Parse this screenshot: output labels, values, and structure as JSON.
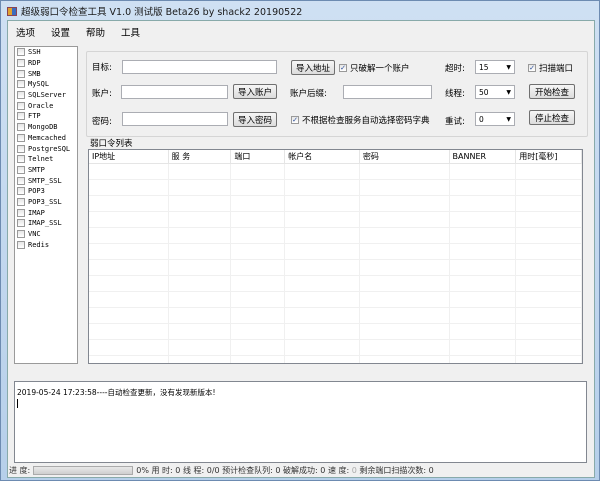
{
  "window": {
    "title": "超级弱口令检查工具 V1.0 测试版 Beta26 by shack2 20190522"
  },
  "menu": [
    "选项",
    "设置",
    "帮助",
    "工具"
  ],
  "services": [
    {
      "name": "SSH",
      "checked": false
    },
    {
      "name": "RDP",
      "checked": false
    },
    {
      "name": "SMB",
      "checked": false
    },
    {
      "name": "MySQL",
      "checked": false
    },
    {
      "name": "SQLServer",
      "checked": false
    },
    {
      "name": "Oracle",
      "checked": false
    },
    {
      "name": "FTP",
      "checked": false
    },
    {
      "name": "MongoDB",
      "checked": false
    },
    {
      "name": "Memcached",
      "checked": false
    },
    {
      "name": "PostgreSQL",
      "checked": false
    },
    {
      "name": "Telnet",
      "checked": false
    },
    {
      "name": "SMTP",
      "checked": false
    },
    {
      "name": "SMTP_SSL",
      "checked": false
    },
    {
      "name": "POP3",
      "checked": false
    },
    {
      "name": "POP3_SSL",
      "checked": false
    },
    {
      "name": "IMAP",
      "checked": false
    },
    {
      "name": "IMAP_SSL",
      "checked": false
    },
    {
      "name": "VNC",
      "checked": false
    },
    {
      "name": "Redis",
      "checked": false
    }
  ],
  "form": {
    "target_label": "目标:",
    "target_value": "",
    "import_target": "导入地址",
    "account_label": "账户:",
    "account_value": "",
    "import_account": "导入账户",
    "password_label": "密码:",
    "password_value": "",
    "import_password": "导入密码",
    "only_one_label": "只破解一个账户",
    "only_one_checked": true,
    "suffix_label": "账户后缀:",
    "suffix_value": "",
    "no_auto_dict_label": "不根据检查服务自动选择密码字典",
    "no_auto_dict_checked": true,
    "timeout_label": "超时:",
    "timeout_value": "15",
    "threads_label": "线程:",
    "threads_value": "50",
    "retry_label": "重试:",
    "retry_value": "0",
    "scan_port_label": "扫描端口",
    "scan_port_checked": true,
    "start": "开始检查",
    "stop": "停止检查"
  },
  "results": {
    "title": "弱口令列表",
    "columns": [
      "IP地址",
      "服 务",
      "端口",
      "帐户名",
      "密码",
      "BANNER",
      "用时[毫秒]"
    ],
    "rows": []
  },
  "log": {
    "lines": [
      "2019-05-24 17:23:58----自动检查更新，没有发现新版本!"
    ]
  },
  "status": {
    "progress_label": "进 度:",
    "progress_percent": 0,
    "progress_text": "0%",
    "elapsed_label": "用 时:",
    "elapsed": "0",
    "threads_label": "线 程:",
    "threads": "0/0",
    "queue_label": "预计检查队列:",
    "queue": "0",
    "success_label": "破解成功:",
    "success": "0",
    "speed_label": "速 度:",
    "speed": "0",
    "remaining_label": "剩余端口扫描次数:",
    "remaining": "0"
  }
}
